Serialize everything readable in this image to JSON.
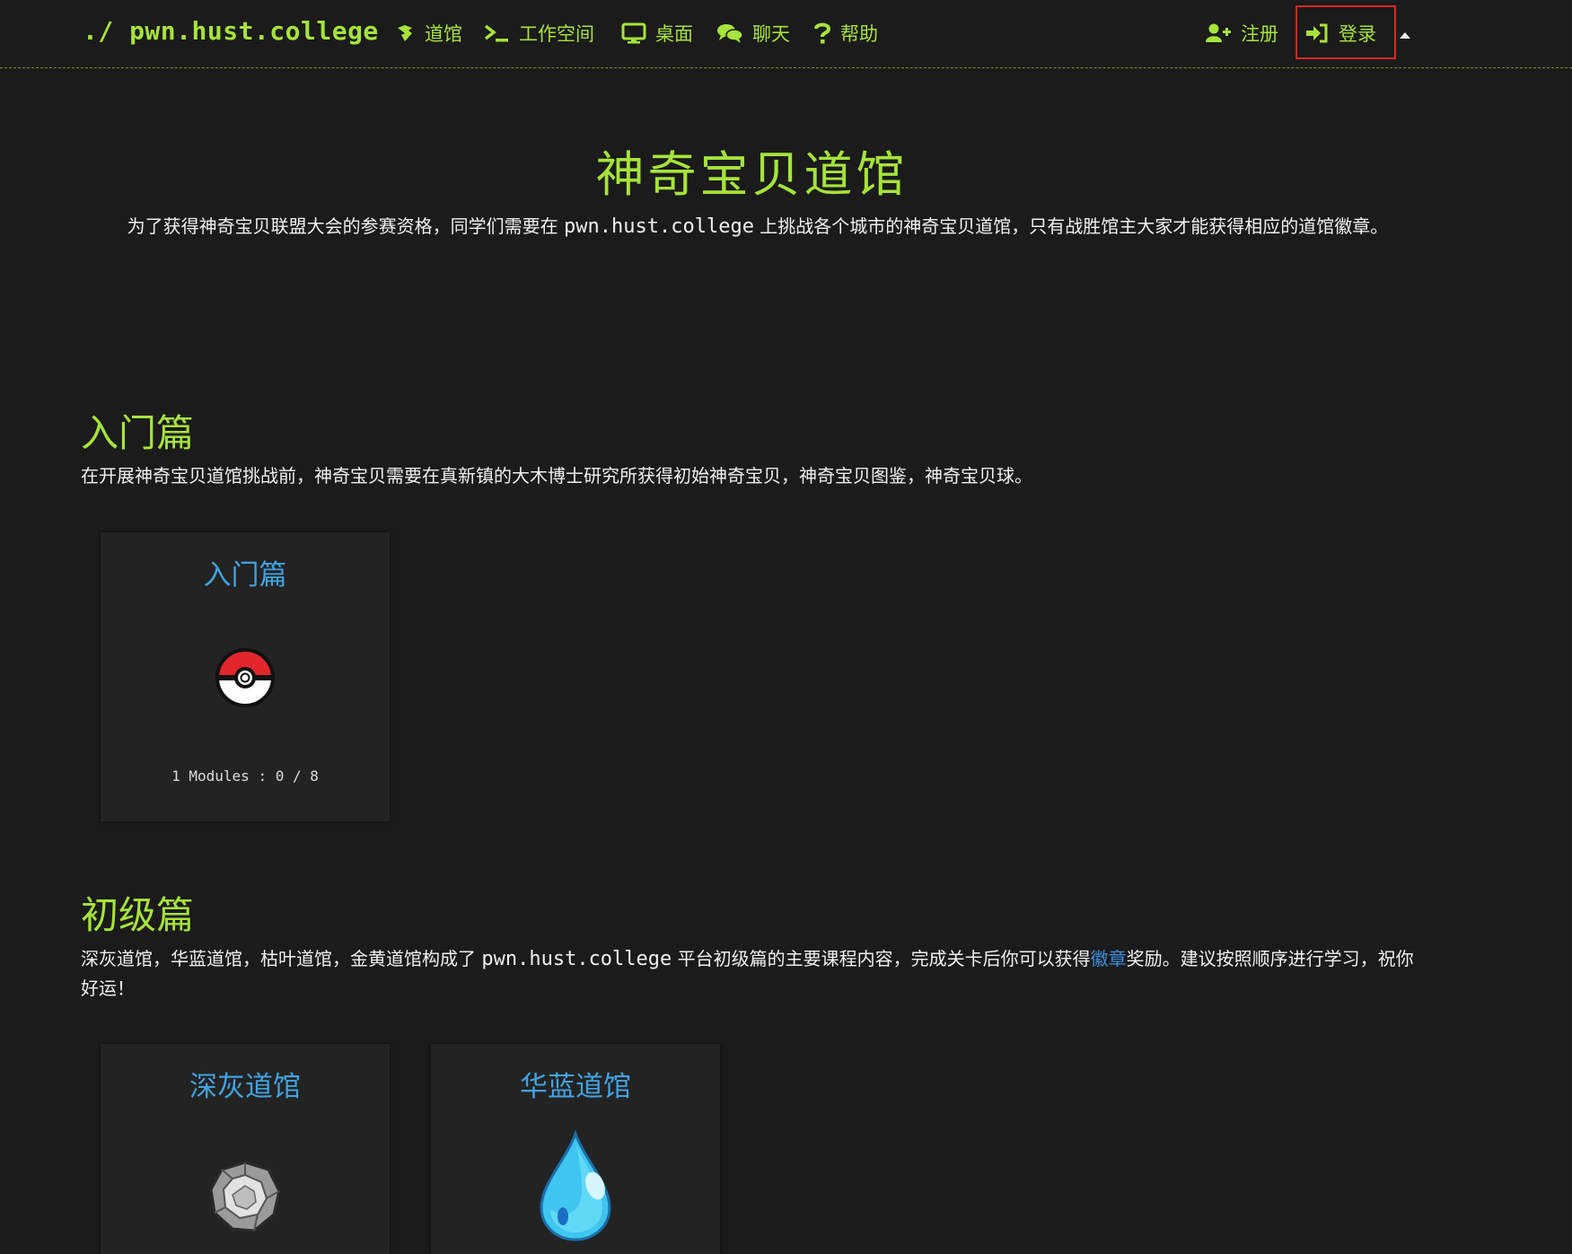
{
  "nav": {
    "brand": "./ pwn.hust.college",
    "items": [
      {
        "label": "道馆",
        "icon": "dojo-icon"
      },
      {
        "label": "工作空间",
        "icon": "terminal-icon"
      },
      {
        "label": "桌面",
        "icon": "desktop-icon"
      },
      {
        "label": "聊天",
        "icon": "chat-icon"
      },
      {
        "label": "帮助",
        "icon": "question-icon"
      }
    ],
    "register": {
      "label": "注册",
      "icon": "user-plus-icon"
    },
    "login": {
      "label": "登录",
      "icon": "sign-in-icon"
    },
    "toggle_icon": "caret-up-icon"
  },
  "hero": {
    "title": "神奇宝贝道馆",
    "desc_before": "为了获得神奇宝贝联盟大会的参赛资格，同学们需要在 ",
    "desc_code": "pwn.hust.college",
    "desc_after": " 上挑战各个城市的神奇宝贝道馆，只有战胜馆主大家才能获得相应的道馆徽章。"
  },
  "sections": [
    {
      "title": "入门篇",
      "desc": "在开展神奇宝贝道馆挑战前，神奇宝贝需要在真新镇的大木博士研究所获得初始神奇宝贝，神奇宝贝图鉴，神奇宝贝球。",
      "cards": [
        {
          "title": "入门篇",
          "icon": "pokeball-icon",
          "meta": "1 Modules : 0 / 8"
        }
      ]
    },
    {
      "title": "初级篇",
      "desc_before": "深灰道馆，华蓝道馆，枯叶道馆，金黄道馆构成了 ",
      "desc_code": "pwn.hust.college",
      "desc_middle": " 平台初级篇的主要课程内容，完成关卡后你可以获得",
      "desc_link": "徽章",
      "desc_after": "奖励。建议按照顺序进行学习，祝你好运！",
      "cards": [
        {
          "title": "深灰道馆",
          "icon": "boulder-badge-icon"
        },
        {
          "title": "华蓝道馆",
          "icon": "water-drop-icon"
        }
      ]
    }
  ],
  "colors": {
    "accent": "#a6e33b",
    "link": "#41a3e0",
    "highlight_box": "#e0261f",
    "background": "#1b1b1b"
  }
}
